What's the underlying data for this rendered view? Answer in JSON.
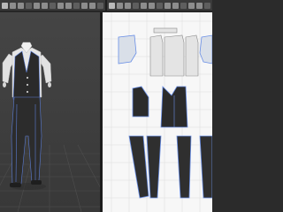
{
  "toolbar": {
    "left_icons": [
      "select-tool-icon",
      "move-tool-icon",
      "rotate-tool-icon",
      "fold-tool-icon",
      "pin-tool-icon",
      "tack-tool-icon",
      "brush-tool-icon",
      "measure-tool-icon",
      "camera-icon",
      "light-icon",
      "avatar-icon",
      "simulation-icon",
      "settings-icon",
      "view-icon"
    ],
    "right_icons": [
      "transform-pattern-icon",
      "edit-point-icon",
      "edit-curve-icon",
      "polygon-icon",
      "rectangle-icon",
      "circle-icon",
      "internal-line-icon",
      "segment-sewing-icon",
      "free-sewing-icon",
      "fold-arrangement-icon",
      "trace-icon",
      "symmetry-icon",
      "settings-icon",
      "view-icon"
    ]
  },
  "viewport_3d": {
    "garment": [
      "dress-shirt",
      "vest",
      "trousers"
    ],
    "colors": {
      "shirt": "#e6e6e6",
      "vest": "#2a2a2a",
      "trousers": "#2c2c2c",
      "seam": "#5b7dd6"
    }
  },
  "pattern_2d": {
    "pieces": [
      "sleeve-left",
      "collar",
      "shirt-front-left",
      "shirt-back",
      "shirt-front-right",
      "sleeve-right",
      "vest-back",
      "vest-front",
      "trouser-front-left",
      "trouser-back-left",
      "trouser-back-right",
      "trouser-front-right"
    ],
    "colors": {
      "shirt": "#dcdcdc",
      "vest": "#2b2b2b",
      "trousers": "#2f2f2f",
      "seam": "#6a8fe6",
      "grid": "#d8d8d8",
      "background": "#f7f7f7"
    }
  }
}
